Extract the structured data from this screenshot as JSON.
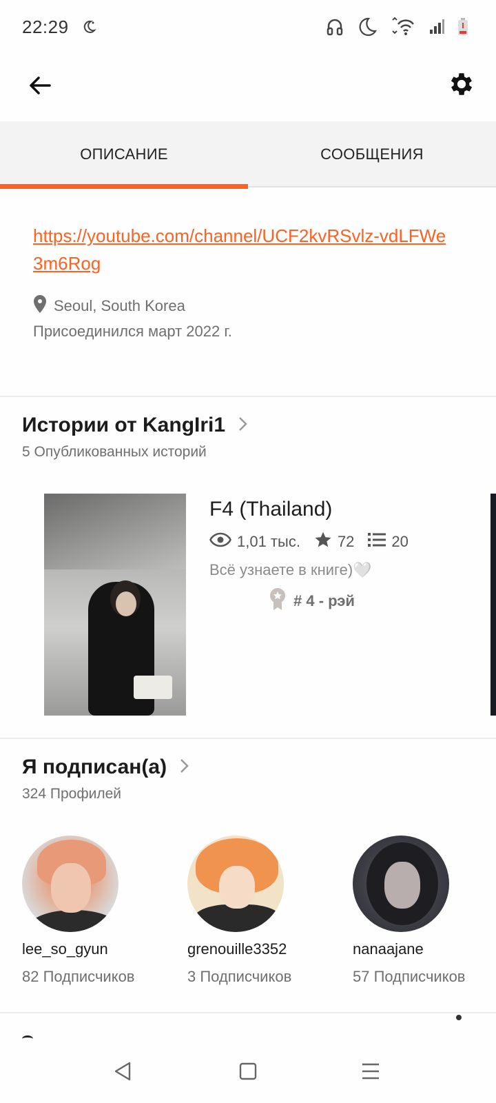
{
  "status_bar": {
    "time": "22:29",
    "icons": [
      "night-mode-icon",
      "headphones-icon",
      "moon-icon",
      "wifi-icon",
      "signal-icon",
      "battery-icon"
    ]
  },
  "toolbar": {
    "back_icon": "arrow-left-icon",
    "settings_icon": "gear-icon"
  },
  "tabs": [
    {
      "label": "ОПИСАНИЕ",
      "active": true
    },
    {
      "label": "СООБЩЕНИЯ",
      "active": false
    }
  ],
  "description": {
    "link": "https://youtube.com/channel/UCF2kvRSvlz-vdLFWe3m6Rog",
    "location": "Seoul, South Korea",
    "joined": "Присоединился март 2022 г."
  },
  "stories": {
    "title": "Истории от KangIri1",
    "subtitle": "5 Опубликованных историй",
    "items": [
      {
        "title": "F4 (Thailand)",
        "views": "1,01 тыс.",
        "votes": "72",
        "parts": "20",
        "description": "Всё узнаете в книге)🤍",
        "rank": "# 4 - рэй"
      }
    ]
  },
  "following": {
    "title": "Я подписан(а)",
    "subtitle": "324 Профилей",
    "profiles": [
      {
        "name": "lee_so_gyun",
        "followers": "82 Подписчиков"
      },
      {
        "name": "grenouille3352",
        "followers": "3 Подписчиков"
      },
      {
        "name": "nanaajane",
        "followers": "57 Подписчиков"
      }
    ]
  },
  "nav_bar": {
    "icons": [
      "back-nav-icon",
      "home-nav-icon",
      "recents-nav-icon"
    ]
  },
  "colors": {
    "accent": "#ff6122",
    "text_primary": "#1c1c1c",
    "text_secondary": "#6f6f6f",
    "tab_bg": "#f3f3f3"
  }
}
